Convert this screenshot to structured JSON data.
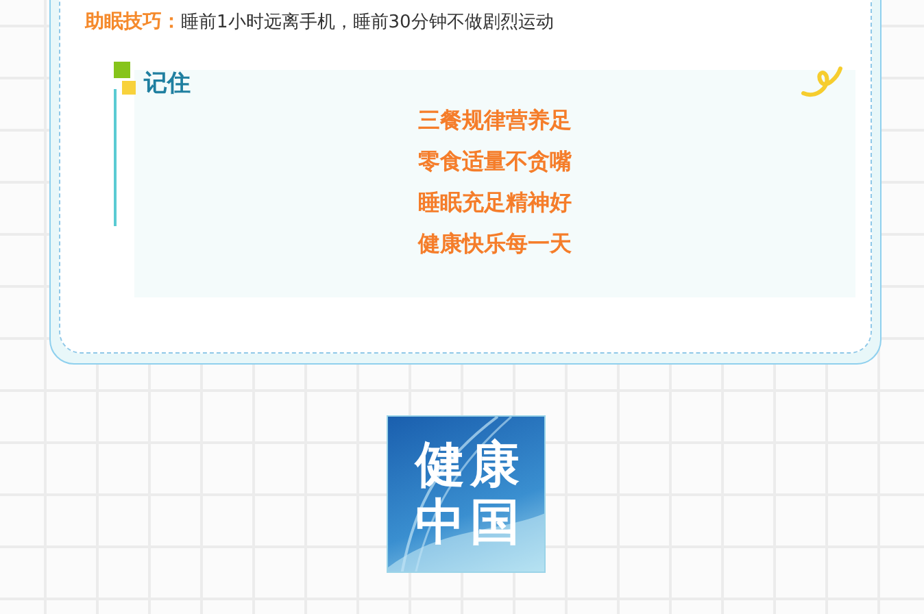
{
  "tip": {
    "label": "助眠技巧：",
    "text": "睡前1小时远离手机，睡前30分钟不做剧烈运动"
  },
  "remember": {
    "title": "记住",
    "lines": [
      "三餐规律营养足",
      "零食适量不贪嘴",
      "睡眠充足精神好",
      "健康快乐每一天"
    ]
  },
  "logo": {
    "lines": [
      "健康",
      "中国"
    ]
  }
}
